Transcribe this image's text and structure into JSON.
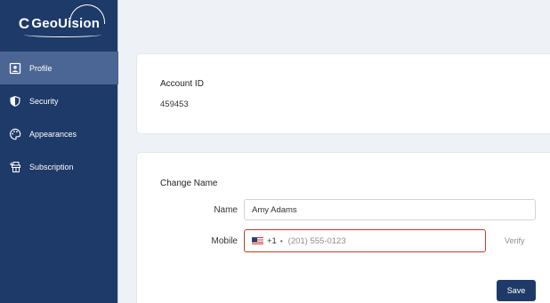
{
  "brand": {
    "logo_text": "GeoUision"
  },
  "sidebar": {
    "items": [
      {
        "label": "Profile",
        "icon": "profile-icon",
        "active": true
      },
      {
        "label": "Security",
        "icon": "shield-icon",
        "active": false
      },
      {
        "label": "Appearances",
        "icon": "palette-icon",
        "active": false
      },
      {
        "label": "Subscription",
        "icon": "subscription-icon",
        "active": false
      }
    ]
  },
  "account": {
    "title": "Account ID",
    "value": "459453"
  },
  "change_name": {
    "title": "Change Name",
    "name_label": "Name",
    "name_value": "Amy Adams",
    "mobile_label": "Mobile",
    "country_code": "+1",
    "mobile_placeholder": "(201) 555-0123",
    "verify_label": "Verify",
    "save_label": "Save"
  },
  "colors": {
    "sidebar_bg": "#1e3a68",
    "active_item_bg": "#4b6594",
    "error_border": "#c0392b",
    "primary_button": "#1e3a68"
  }
}
